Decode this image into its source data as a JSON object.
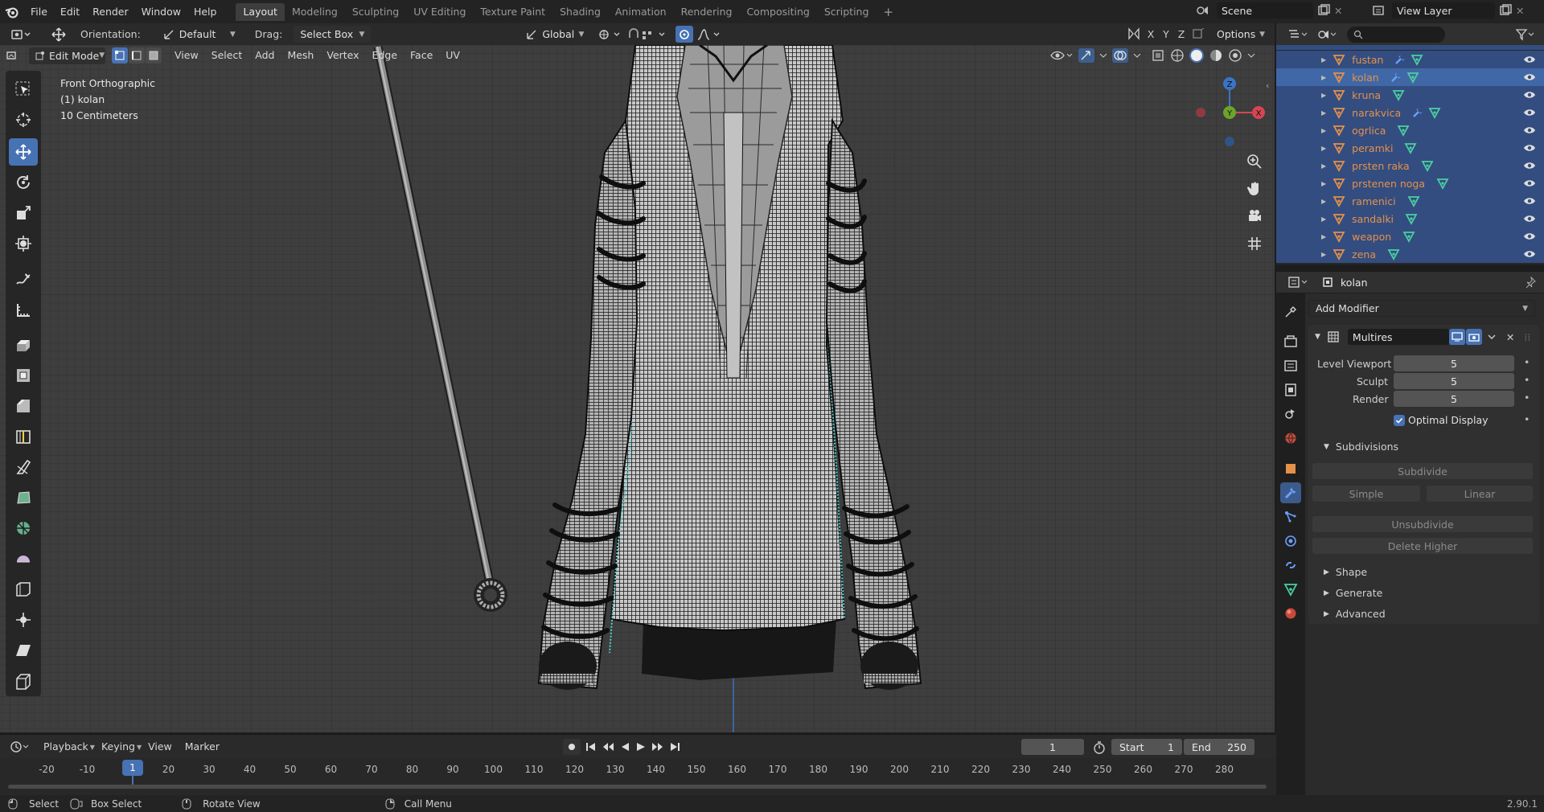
{
  "topbar": {
    "menus": [
      "File",
      "Edit",
      "Render",
      "Window",
      "Help"
    ],
    "workspaces": [
      "Layout",
      "Modeling",
      "Sculpting",
      "UV Editing",
      "Texture Paint",
      "Shading",
      "Animation",
      "Rendering",
      "Compositing",
      "Scripting"
    ],
    "active_workspace": "Layout",
    "add_tab": "+",
    "scene": "Scene",
    "view_layer": "View Layer"
  },
  "tool_header": {
    "orientation_label": "Orientation:",
    "orientation_value": "Default",
    "drag_label": "Drag:",
    "drag_value": "Select Box",
    "transform_orientation": "Global",
    "options": "Options",
    "axes": [
      "X",
      "Y",
      "Z"
    ]
  },
  "viewport_header": {
    "mode": "Edit Mode",
    "menus": [
      "View",
      "Select",
      "Add",
      "Mesh",
      "Vertex",
      "Edge",
      "Face",
      "UV"
    ]
  },
  "viewport_info": {
    "view": "Front Orthographic",
    "object": "(1) kolan",
    "scale": "10 Centimeters"
  },
  "gizmo": {
    "x": "X",
    "y": "Y",
    "z": "Z"
  },
  "outliner": {
    "items": [
      {
        "name": "fustan",
        "modifier": true,
        "selected": true
      },
      {
        "name": "kolan",
        "modifier": true,
        "selected": true,
        "active": true
      },
      {
        "name": "kruna",
        "modifier": false,
        "selected": true
      },
      {
        "name": "narakvica",
        "modifier": true,
        "selected": true
      },
      {
        "name": "ogrlica",
        "modifier": false,
        "selected": true
      },
      {
        "name": "peramki",
        "modifier": false,
        "selected": true
      },
      {
        "name": "prsten raka",
        "modifier": false,
        "selected": true
      },
      {
        "name": "prstenen noga",
        "modifier": false,
        "selected": true
      },
      {
        "name": "ramenici",
        "modifier": false,
        "selected": true
      },
      {
        "name": "sandalki",
        "modifier": false,
        "selected": true
      },
      {
        "name": "weapon",
        "modifier": false,
        "selected": true
      },
      {
        "name": "zena",
        "modifier": false,
        "selected": true
      }
    ]
  },
  "properties": {
    "object_name": "kolan",
    "add_modifier": "Add Modifier",
    "modifier_name": "Multires",
    "fields": [
      {
        "label": "Level Viewport",
        "value": "5"
      },
      {
        "label": "Sculpt",
        "value": "5"
      },
      {
        "label": "Render",
        "value": "5"
      }
    ],
    "optimal_display": "Optimal Display",
    "subdivisions": "Subdivisions",
    "subdivide": "Subdivide",
    "simple": "Simple",
    "linear": "Linear",
    "unsubdivide": "Unsubdivide",
    "delete_higher": "Delete Higher",
    "sections": [
      "Shape",
      "Generate",
      "Advanced"
    ]
  },
  "timeline": {
    "menus": [
      "Playback",
      "Keying",
      "View",
      "Marker"
    ],
    "current_frame": "1",
    "start_label": "Start",
    "start": "1",
    "end_label": "End",
    "end": "250",
    "ticks": [
      "-20",
      "-10",
      "1",
      "10",
      "20",
      "30",
      "40",
      "50",
      "60",
      "70",
      "80",
      "90",
      "100",
      "110",
      "120",
      "130",
      "140",
      "150",
      "160",
      "170",
      "180",
      "190",
      "200",
      "210",
      "220",
      "230",
      "240",
      "250",
      "260",
      "270",
      "280"
    ]
  },
  "statusbar": {
    "select": "Select",
    "box_select": "Box Select",
    "rotate_view": "Rotate View",
    "call_menu": "Call Menu",
    "version": "2.90.1"
  },
  "colors": {
    "accent": "#4772b3",
    "object_orange": "#e5914a",
    "selection_cyan": "#4bc4c4",
    "outliner_selected": "#334d80"
  }
}
